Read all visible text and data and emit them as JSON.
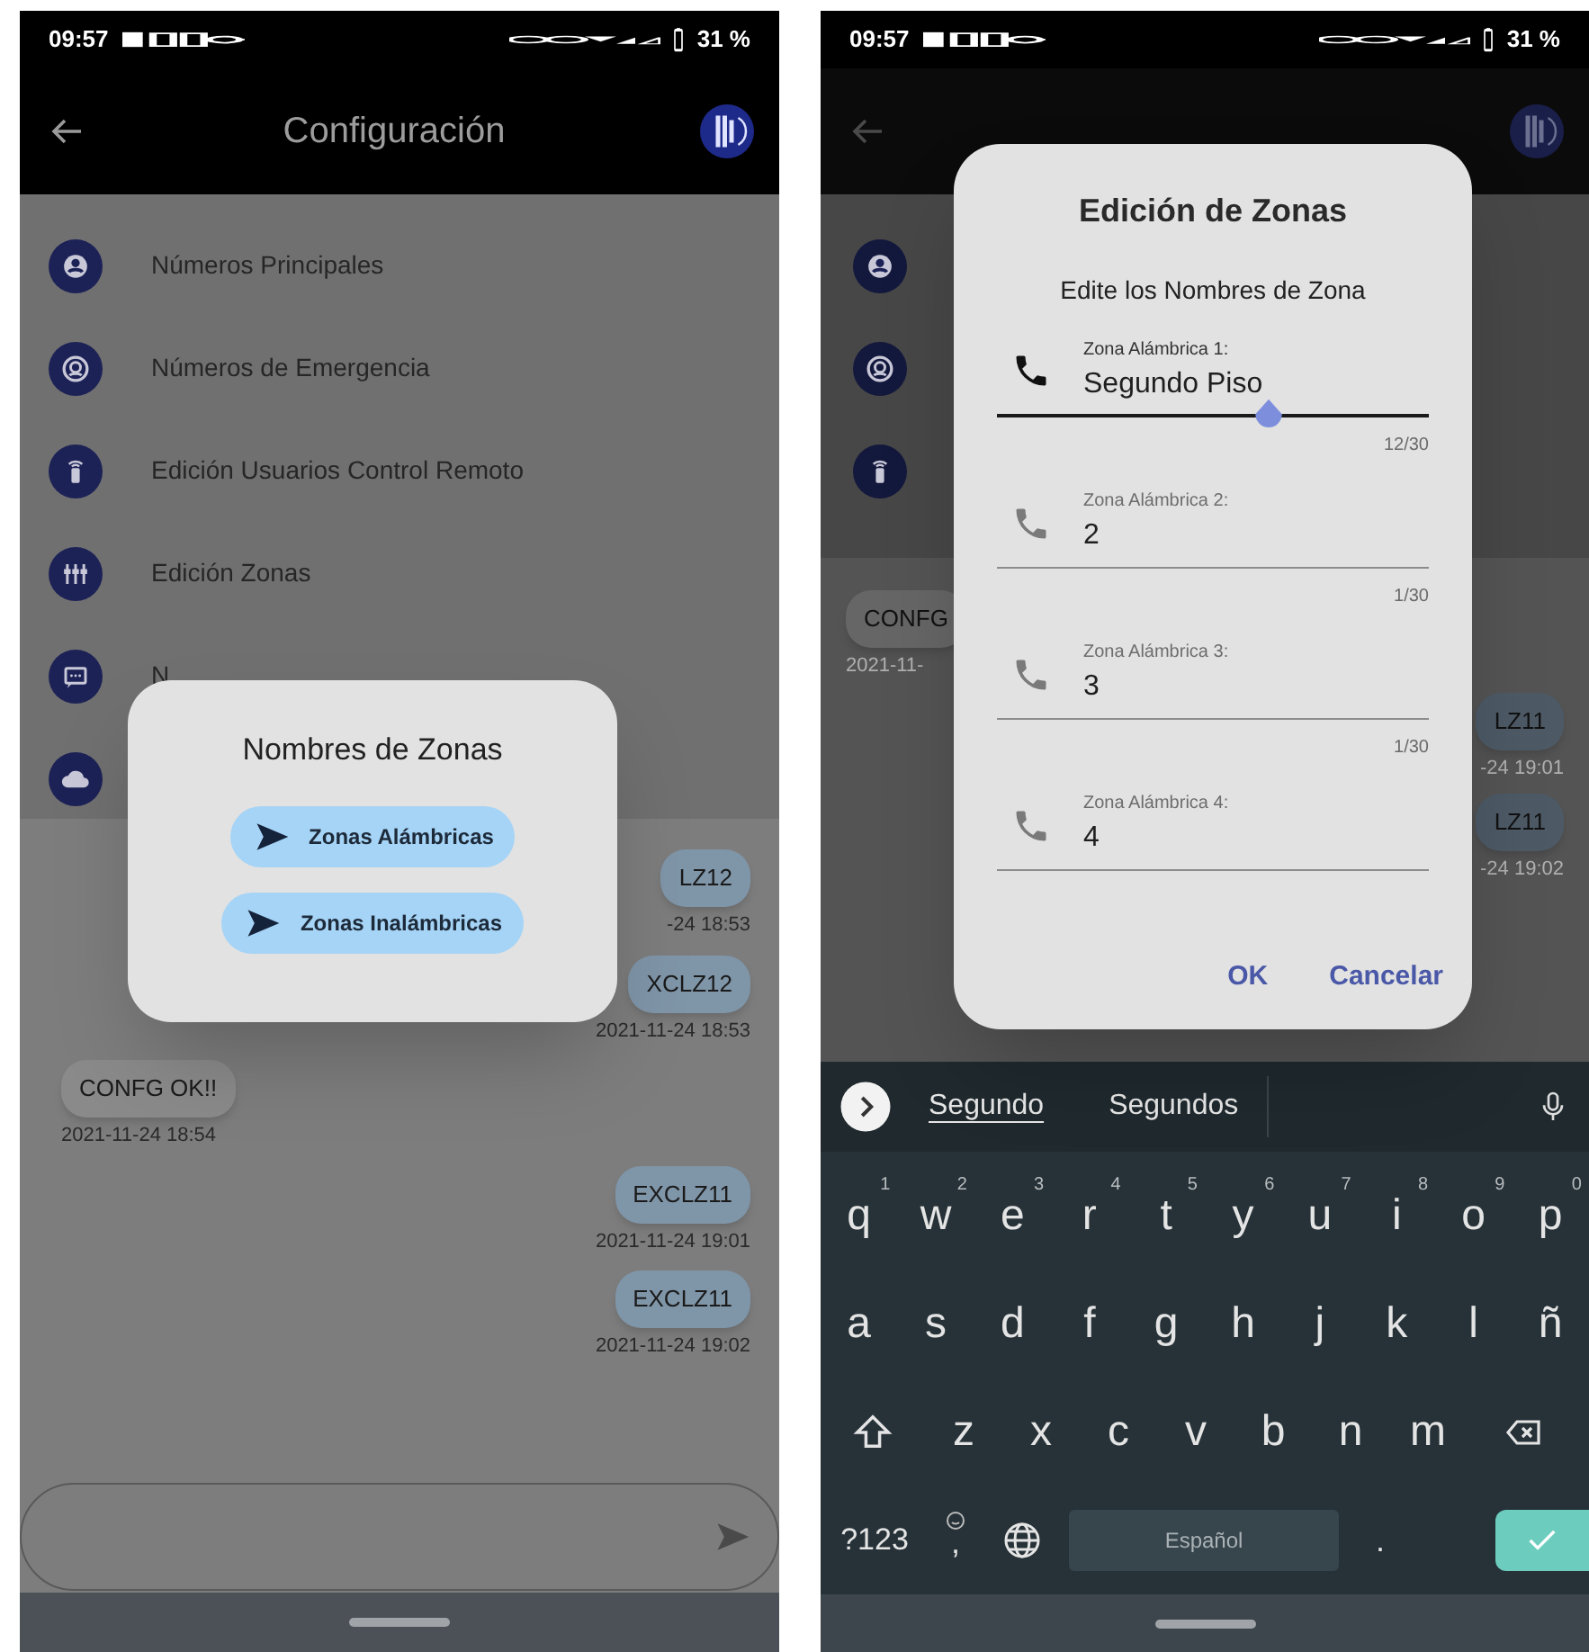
{
  "left_screen": {
    "status_bar": {
      "time": "09:57",
      "battery": "31 %"
    },
    "app_bar": {
      "title": "Configuración"
    },
    "menu": [
      {
        "label": "Números Principales"
      },
      {
        "label": "Números de Emergencia"
      },
      {
        "label": "Edición Usuarios Control Remoto"
      },
      {
        "label": "Edición Zonas"
      },
      {
        "label": "N"
      }
    ],
    "messages": [
      {
        "text": "LZ12",
        "time": "-24 18:53",
        "outgoing": true
      },
      {
        "text": "XCLZ12",
        "time": "2021-11-24 18:53",
        "outgoing": true
      },
      {
        "text": "CONFG OK!!",
        "time": "2021-11-24 18:54",
        "outgoing": false
      },
      {
        "text": "EXCLZ11",
        "time": "2021-11-24 19:01",
        "outgoing": true
      },
      {
        "text": "EXCLZ11",
        "time": "2021-11-24 19:02",
        "outgoing": true
      }
    ],
    "dialog": {
      "title": "Nombres de Zonas",
      "buttons": [
        "Zonas Alámbricas",
        "Zonas Inalámbricas"
      ]
    }
  },
  "right_screen": {
    "status_bar": {
      "time": "09:57",
      "battery": "31 %"
    },
    "messages": [
      {
        "text": "CONFG",
        "time": "2021-11-",
        "outgoing": false
      },
      {
        "text": "LZ11",
        "time": "-24 19:01",
        "outgoing": true
      },
      {
        "text": "LZ11",
        "time": "-24 19:02",
        "outgoing": true
      }
    ],
    "dialog": {
      "title": "Edición de Zonas",
      "subtitle": "Edite los Nombres de Zona",
      "fields": [
        {
          "label": "Zona Alámbrica 1:",
          "value": "Segundo Piso",
          "counter": "12/30",
          "focused": true
        },
        {
          "label": "Zona Alámbrica 2:",
          "value": "2",
          "counter": "1/30",
          "focused": false
        },
        {
          "label": "Zona Alámbrica 3:",
          "value": "3",
          "counter": "1/30",
          "focused": false
        },
        {
          "label": "Zona Alámbrica 4:",
          "value": "4",
          "focused": false
        }
      ],
      "buttons": [
        "OK",
        "Cancelar"
      ]
    },
    "keyboard": {
      "suggestions": [
        {
          "text": "Segundo",
          "selected": true
        },
        {
          "text": "Segundos",
          "selected": false
        }
      ],
      "rows": [
        [
          {
            "key": "q",
            "hint": "1"
          },
          {
            "key": "w",
            "hint": "2"
          },
          {
            "key": "e",
            "hint": "3"
          },
          {
            "key": "r",
            "hint": "4"
          },
          {
            "key": "t",
            "hint": "5"
          },
          {
            "key": "y",
            "hint": "6"
          },
          {
            "key": "u",
            "hint": "7"
          },
          {
            "key": "i",
            "hint": "8"
          },
          {
            "key": "o",
            "hint": "9"
          },
          {
            "key": "p",
            "hint": "0"
          }
        ],
        [
          {
            "key": "a"
          },
          {
            "key": "s"
          },
          {
            "key": "d"
          },
          {
            "key": "f"
          },
          {
            "key": "g"
          },
          {
            "key": "h"
          },
          {
            "key": "j"
          },
          {
            "key": "k"
          },
          {
            "key": "l"
          },
          {
            "key": "ñ"
          }
        ],
        [
          {
            "kind": "shift"
          },
          {
            "key": "z"
          },
          {
            "key": "x"
          },
          {
            "key": "c"
          },
          {
            "key": "v"
          },
          {
            "key": "b"
          },
          {
            "key": "n"
          },
          {
            "key": "m"
          },
          {
            "kind": "backspace"
          }
        ]
      ],
      "bottom_keys": {
        "symbols": "?123",
        "comma": ",",
        "space": "Español",
        "period": "."
      }
    }
  }
}
